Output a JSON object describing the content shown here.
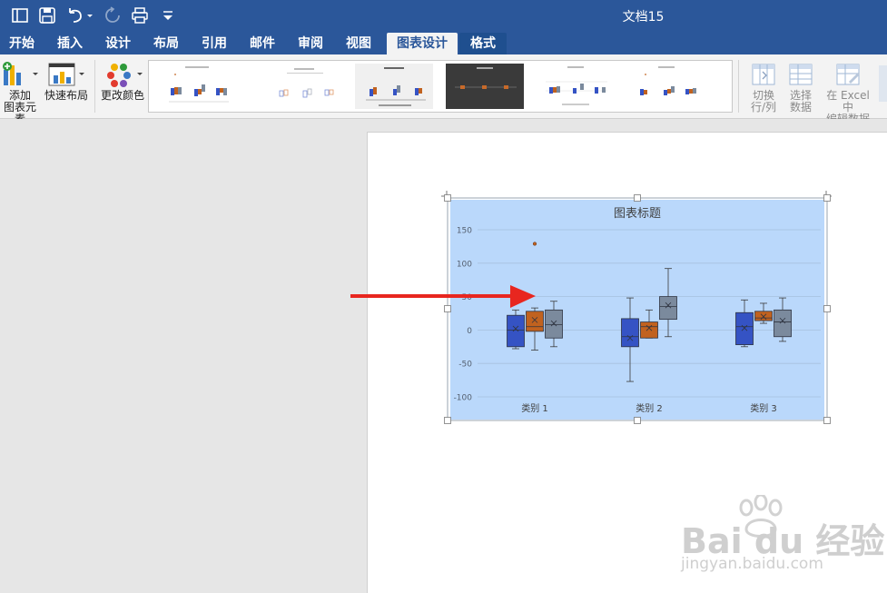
{
  "window": {
    "title": "文档15"
  },
  "tabs": [
    {
      "label": "开始"
    },
    {
      "label": "插入"
    },
    {
      "label": "设计"
    },
    {
      "label": "布局"
    },
    {
      "label": "引用"
    },
    {
      "label": "邮件"
    },
    {
      "label": "审阅"
    },
    {
      "label": "视图"
    },
    {
      "label": "图表设计"
    },
    {
      "label": "格式"
    }
  ],
  "ribbon": {
    "add_element_l1": "添加",
    "add_element_l2": "图表元素",
    "quick_layout": "快速布局",
    "change_colors": "更改颜色",
    "switch_row_col_l1": "切换",
    "switch_row_col_l2": "行/列",
    "select_data_l1": "选择",
    "select_data_l2": "数据",
    "edit_excel_l1": "在 Excel 中",
    "edit_excel_l2": "编辑数据"
  },
  "colors": {
    "accent": "#2b579a",
    "series1": "#3553c4",
    "series2": "#c1621f",
    "series3": "#7b8a9d",
    "chart_fill": "#bad8fb",
    "arrow": "#e8261f"
  },
  "watermark": {
    "brand": "Bai du 经验",
    "url": "jingyan.baidu.com"
  },
  "chart_data": {
    "type": "box",
    "title": "图表标题",
    "categories": [
      "类别 1",
      "类别 2",
      "类别 3"
    ],
    "ylim": [
      -100,
      150
    ],
    "yticks": [
      150,
      100,
      50,
      0,
      -50,
      -100
    ],
    "grid": true,
    "series": [
      {
        "boxes": [
          {
            "min": -28,
            "q1": -25,
            "median": 0,
            "q3": 22,
            "max": 30,
            "mean": 2
          },
          {
            "min": -77,
            "q1": -25,
            "median": -10,
            "q3": 17,
            "max": 48,
            "mean": -12
          },
          {
            "min": -25,
            "q1": -22,
            "median": 5,
            "q3": 26,
            "max": 45,
            "mean": 3
          }
        ]
      },
      {
        "boxes": [
          {
            "min": -30,
            "q1": -2,
            "median": 5,
            "q3": 28,
            "max": 33,
            "mean": 15,
            "outliers": [
              129
            ]
          },
          {
            "min": -12,
            "q1": -12,
            "median": 5,
            "q3": 12,
            "max": 30,
            "mean": 3
          },
          {
            "min": 10,
            "q1": 14,
            "median": 18,
            "q3": 28,
            "max": 40,
            "mean": 20
          }
        ]
      },
      {
        "boxes": [
          {
            "min": -25,
            "q1": -12,
            "median": 8,
            "q3": 30,
            "max": 43,
            "mean": 10
          },
          {
            "min": -10,
            "q1": 16,
            "median": 35,
            "q3": 50,
            "max": 92,
            "mean": 37
          },
          {
            "min": -17,
            "q1": -10,
            "median": 12,
            "q3": 30,
            "max": 48,
            "mean": 14
          }
        ]
      }
    ]
  }
}
